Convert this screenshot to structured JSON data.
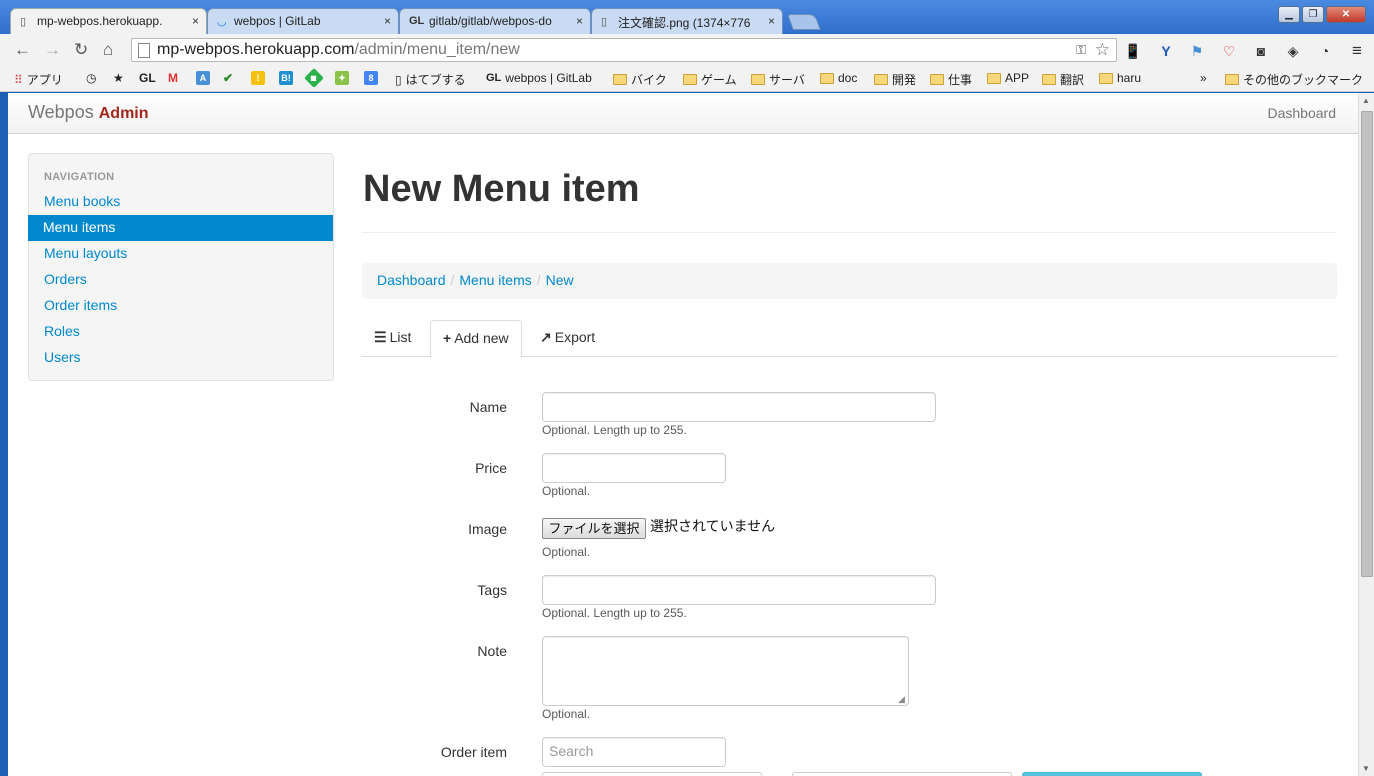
{
  "browser": {
    "tabs": [
      {
        "title": "mp-webpos.herokuapp.",
        "icon": "page-icon",
        "active": true
      },
      {
        "title": "webpos | GitLab",
        "icon": "loading-icon",
        "active": false
      },
      {
        "title": "gitlab/gitlab/webpos-do",
        "icon": "gitlab-icon",
        "active": false
      },
      {
        "title": "注文確認.png (1374×776",
        "icon": "page-icon",
        "active": false
      }
    ],
    "close_glyph": "×",
    "url_host": "mp-webpos.herokuapp.com",
    "url_path": "/admin/menu_item/new",
    "bookmarks": [
      {
        "label": "アプリ",
        "icon": "apps-icon"
      },
      {
        "label": "GL",
        "icon": "gitlab-icon"
      },
      {
        "label": "M",
        "icon": "gmail-icon"
      },
      {
        "label": "B!",
        "icon": "hatena-icon"
      },
      {
        "label": "はてブする",
        "icon": "page-icon"
      },
      {
        "label": "webpos | GitLab",
        "icon": "gitlab-icon"
      },
      {
        "label": "バイク",
        "icon": "folder-icon"
      },
      {
        "label": "ゲーム",
        "icon": "folder-icon"
      },
      {
        "label": "サーバ",
        "icon": "folder-icon"
      },
      {
        "label": "doc",
        "icon": "folder-icon"
      },
      {
        "label": "開発",
        "icon": "folder-icon"
      },
      {
        "label": "仕事",
        "icon": "folder-icon"
      },
      {
        "label": "APP",
        "icon": "folder-icon"
      },
      {
        "label": "翻訳",
        "icon": "folder-icon"
      },
      {
        "label": "haru",
        "icon": "folder-icon"
      },
      {
        "label": "»",
        "icon": ""
      },
      {
        "label": "その他のブックマーク",
        "icon": "folder-icon"
      }
    ]
  },
  "navbar": {
    "brand": "Webpos",
    "brand_suffix": "Admin",
    "right_link": "Dashboard"
  },
  "sidebar": {
    "header": "Navigation",
    "items": [
      {
        "label": "Menu books",
        "active": false
      },
      {
        "label": "Menu items",
        "active": true
      },
      {
        "label": "Menu layouts",
        "active": false
      },
      {
        "label": "Orders",
        "active": false
      },
      {
        "label": "Order items",
        "active": false
      },
      {
        "label": "Roles",
        "active": false
      },
      {
        "label": "Users",
        "active": false
      }
    ]
  },
  "main": {
    "title": "New Menu item",
    "breadcrumb": [
      "Dashboard",
      "Menu items",
      "New"
    ],
    "breadcrumb_sep": "/",
    "tabs": [
      {
        "label": "List",
        "icon": "list-icon",
        "active": false
      },
      {
        "label": "Add new",
        "icon": "plus-icon",
        "active": true
      },
      {
        "label": "Export",
        "icon": "share-icon",
        "active": false
      }
    ]
  },
  "form": {
    "name": {
      "label": "Name",
      "value": "",
      "help": "Optional. Length up to 255."
    },
    "price": {
      "label": "Price",
      "value": "",
      "help": "Optional."
    },
    "image": {
      "label": "Image",
      "button": "ファイルを選択",
      "status": "選択されていません",
      "help": "Optional."
    },
    "tags": {
      "label": "Tags",
      "value": "",
      "help": "Optional. Length up to 255."
    },
    "note": {
      "label": "Note",
      "value": "",
      "help": "Optional."
    },
    "order_item": {
      "label": "Order item",
      "placeholder": "Search"
    }
  },
  "colors": {
    "link": "#0088cc",
    "active_nav_bg": "#0088cc",
    "brand_admin": "#a3281e"
  }
}
